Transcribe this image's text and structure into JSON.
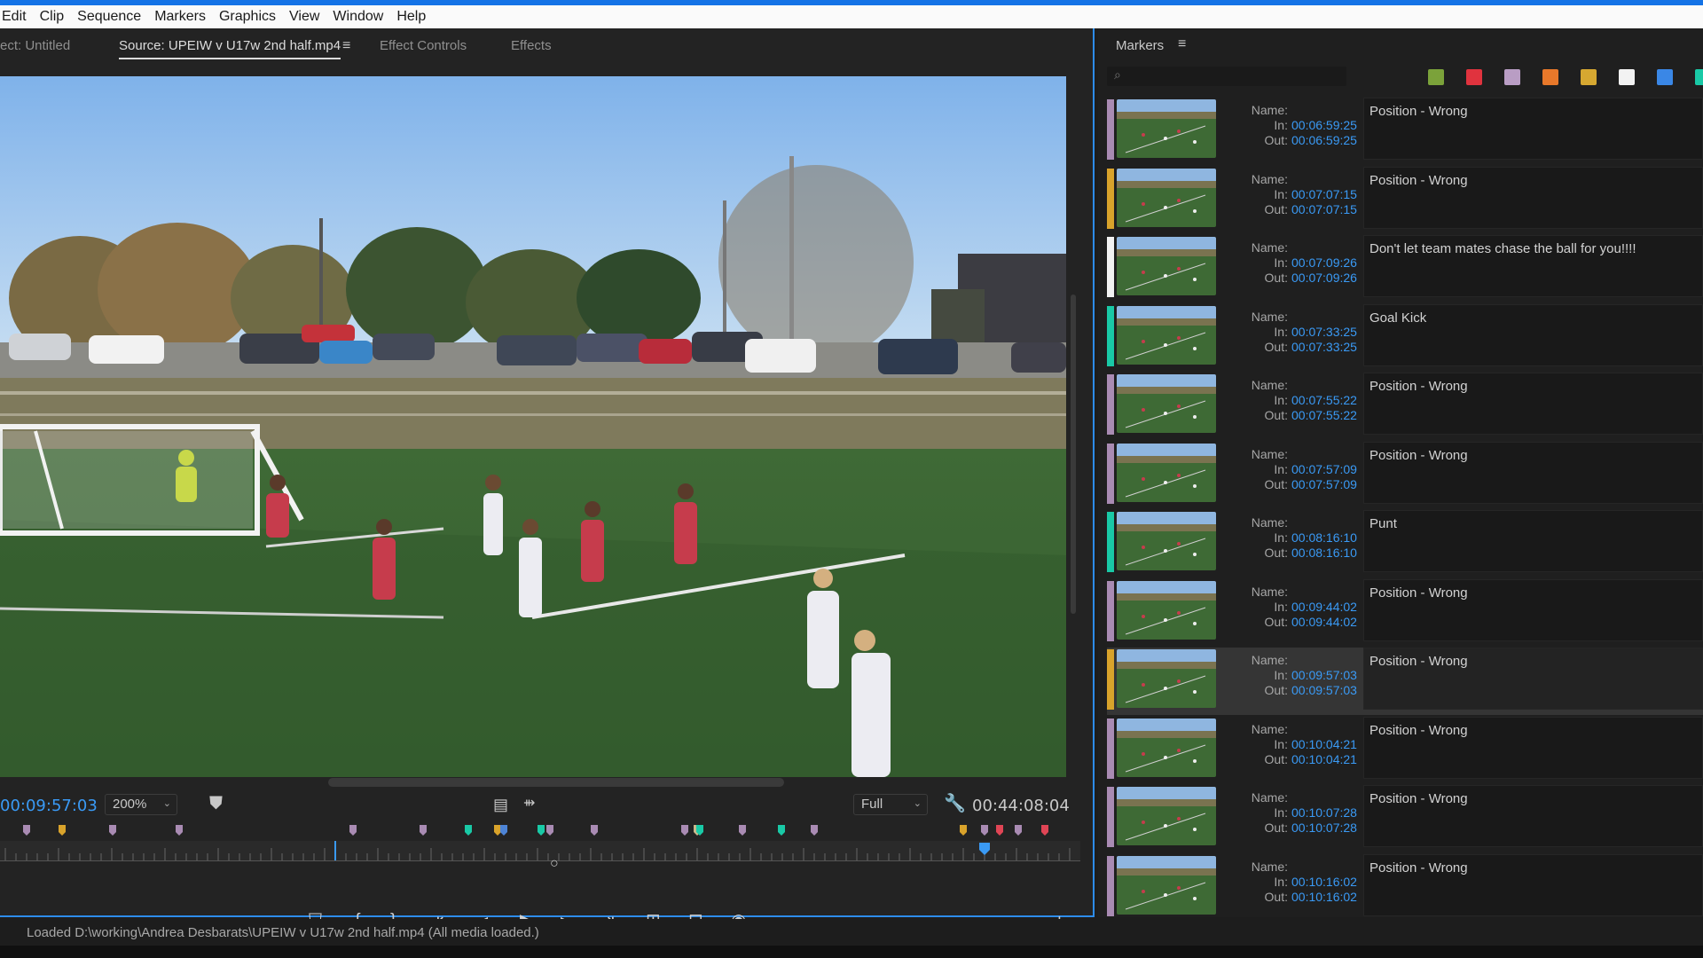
{
  "menu": [
    "Edit",
    "Clip",
    "Sequence",
    "Markers",
    "Graphics",
    "View",
    "Window",
    "Help"
  ],
  "source_panel": {
    "tabs": {
      "project": "ect: Untitled",
      "source": "Source: UPEIW v U17w 2nd half.mp4",
      "effect_controls": "Effect Controls",
      "effects": "Effects"
    },
    "current_timecode": "00:09:57:03",
    "zoom": "200%",
    "playback_resolution": "Full",
    "duration_timecode": "00:44:08:04",
    "marker_strip_colors": [
      "#a98bb3",
      "#d9a32b",
      "#a98bb3",
      "#a98bb3",
      "#a98bb3",
      "#a98bb3",
      "#19c9a6",
      "#d9a32b",
      "#4d84d6",
      "#19c9a6",
      "#a98bb3",
      "#a98bb3",
      "#a98bb3",
      "#c9b98c",
      "#19c9a6",
      "#a98bb3",
      "#19c9a6",
      "#a98bb3",
      "#d9a32b",
      "#a98bb3",
      "#e04555",
      "#a98bb3",
      "#e04555"
    ]
  },
  "markers_panel": {
    "title": "Markers",
    "swatches": [
      "#7ba23a",
      "#e0333e",
      "#b99dc4",
      "#e8782a",
      "#d6a831",
      "#f2f2f2",
      "#3a87e6",
      "#19c9a6"
    ],
    "labels": {
      "name": "Name:",
      "in": "In:",
      "out": "Out:"
    },
    "items": [
      {
        "in": "00:06:59:25",
        "out": "00:06:59:25",
        "comment": "Position - Wrong",
        "color": "#a98bb3"
      },
      {
        "in": "00:07:07:15",
        "out": "00:07:07:15",
        "comment": "Position - Wrong",
        "color": "#d9a32b"
      },
      {
        "in": "00:07:09:26",
        "out": "00:07:09:26",
        "comment": "Don't let team mates chase the ball for you!!!!",
        "color": "#f2f2f2"
      },
      {
        "in": "00:07:33:25",
        "out": "00:07:33:25",
        "comment": "Goal Kick",
        "color": "#19c9a6"
      },
      {
        "in": "00:07:55:22",
        "out": "00:07:55:22",
        "comment": "Position - Wrong",
        "color": "#a98bb3"
      },
      {
        "in": "00:07:57:09",
        "out": "00:07:57:09",
        "comment": "Position - Wrong",
        "color": "#a98bb3"
      },
      {
        "in": "00:08:16:10",
        "out": "00:08:16:10",
        "comment": "Punt",
        "color": "#19c9a6"
      },
      {
        "in": "00:09:44:02",
        "out": "00:09:44:02",
        "comment": "Position - Wrong",
        "color": "#a98bb3"
      },
      {
        "in": "00:09:57:03",
        "out": "00:09:57:03",
        "comment": "Position - Wrong",
        "color": "#d9a32b",
        "selected": true
      },
      {
        "in": "00:10:04:21",
        "out": "00:10:04:21",
        "comment": "Position - Wrong",
        "color": "#a98bb3"
      },
      {
        "in": "00:10:07:28",
        "out": "00:10:07:28",
        "comment": "Position - Wrong",
        "color": "#a98bb3"
      },
      {
        "in": "00:10:16:02",
        "out": "00:10:16:02",
        "comment": "Position - Wrong",
        "color": "#a98bb3"
      }
    ]
  },
  "status_bar": "Loaded D:\\working\\Andrea Desbarats\\UPEIW v U17w 2nd half.mp4 (All media loaded.)"
}
